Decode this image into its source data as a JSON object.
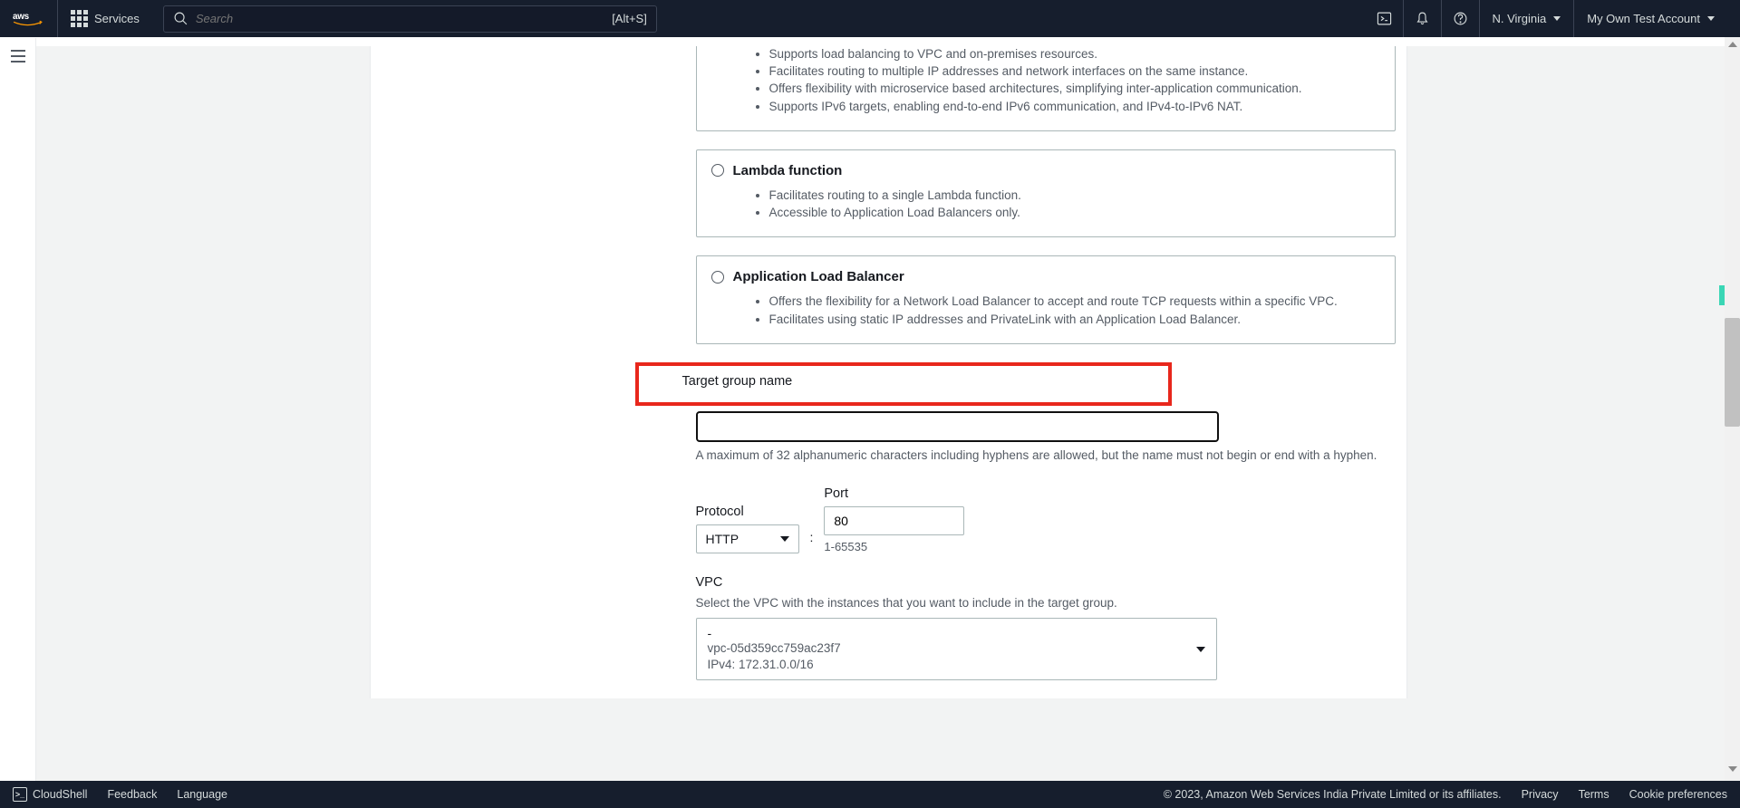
{
  "header": {
    "services_label": "Services",
    "search_placeholder": "Search",
    "search_shortcut": "[Alt+S]",
    "region": "N. Virginia",
    "account": "My Own Test Account"
  },
  "main": {
    "option_ip_partial": {
      "bullets": [
        "Supports load balancing to VPC and on-premises resources.",
        "Facilitates routing to multiple IP addresses and network interfaces on the same instance.",
        "Offers flexibility with microservice based architectures, simplifying inter-application communication.",
        "Supports IPv6 targets, enabling end-to-end IPv6 communication, and IPv4-to-IPv6 NAT."
      ]
    },
    "option_lambda": {
      "title": "Lambda function",
      "bullets": [
        "Facilitates routing to a single Lambda function.",
        "Accessible to Application Load Balancers only."
      ]
    },
    "option_alb": {
      "title": "Application Load Balancer",
      "bullets": [
        "Offers the flexibility for a Network Load Balancer to accept and route TCP requests within a specific VPC.",
        "Facilitates using static IP addresses and PrivateLink with an Application Load Balancer."
      ]
    },
    "tg_name": {
      "label": "Target group name",
      "value": "",
      "help": "A maximum of 32 alphanumeric characters including hyphens are allowed, but the name must not begin or end with a hyphen."
    },
    "protocol": {
      "label": "Protocol",
      "value": "HTTP"
    },
    "port": {
      "label": "Port",
      "value": "80",
      "range": "1-65535"
    },
    "vpc": {
      "label": "VPC",
      "help": "Select the VPC with the instances that you want to include in the target group.",
      "dash": "-",
      "id": "vpc-05d359cc759ac23f7",
      "cidr": "IPv4: 172.31.0.0/16"
    }
  },
  "footer": {
    "cloudshell": "CloudShell",
    "feedback": "Feedback",
    "language": "Language",
    "copyright": "© 2023, Amazon Web Services India Private Limited or its affiliates.",
    "privacy": "Privacy",
    "terms": "Terms",
    "cookies": "Cookie preferences"
  }
}
